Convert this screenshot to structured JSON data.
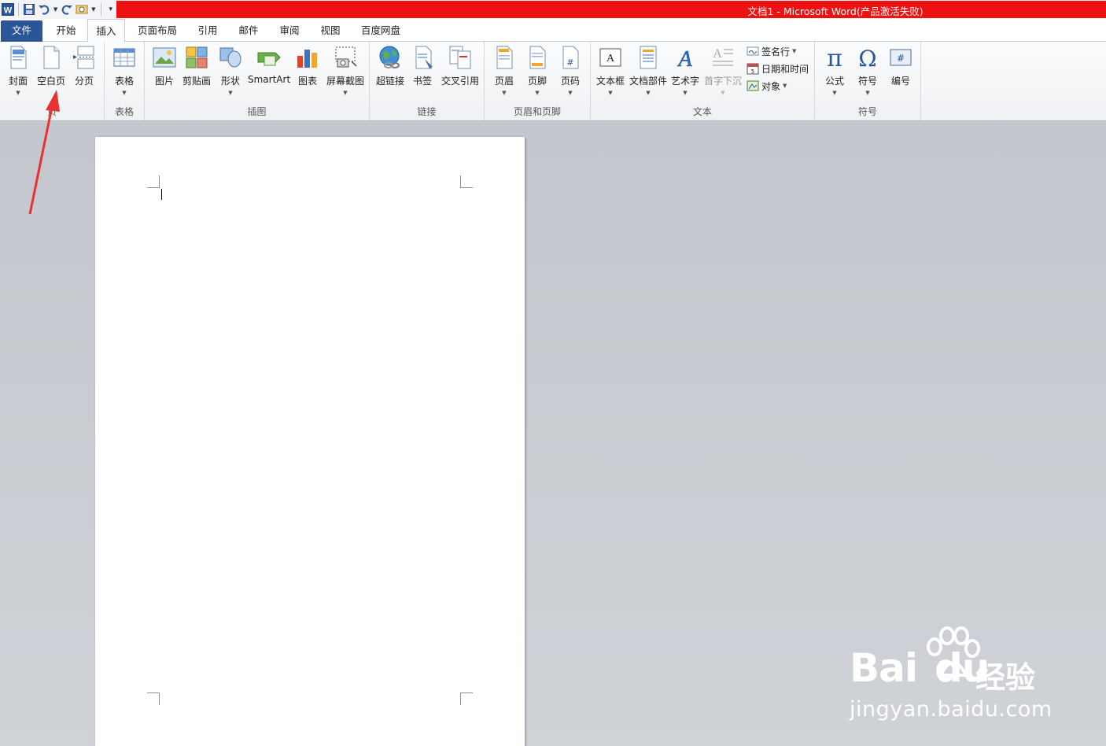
{
  "window": {
    "title": "文档1 - Microsoft Word(产品激活失败)",
    "title_bar_color": "#ee1111"
  },
  "quick_access": {
    "icons": [
      "word-logo-icon",
      "save-icon",
      "undo-icon",
      "redo-icon",
      "customize-icon",
      "dropdown-icon"
    ]
  },
  "tabs": [
    {
      "label": "文件"
    },
    {
      "label": "开始"
    },
    {
      "label": "插入"
    },
    {
      "label": "页面布局"
    },
    {
      "label": "引用"
    },
    {
      "label": "邮件"
    },
    {
      "label": "审阅"
    },
    {
      "label": "视图"
    },
    {
      "label": "百度网盘"
    }
  ],
  "active_tab": "插入",
  "ribbon": {
    "groups": [
      {
        "label": "页",
        "buttons": [
          "封面",
          "空白页",
          "分页"
        ]
      },
      {
        "label": "表格",
        "buttons": [
          "表格"
        ]
      },
      {
        "label": "插图",
        "buttons": [
          "图片",
          "剪贴画",
          "形状",
          "SmartArt",
          "图表",
          "屏幕截图"
        ]
      },
      {
        "label": "链接",
        "buttons": [
          "超链接",
          "书签",
          "交叉引用"
        ]
      },
      {
        "label": "页眉和页脚",
        "buttons": [
          "页眉",
          "页脚",
          "页码"
        ]
      },
      {
        "label": "文本",
        "buttons": [
          "文本框",
          "文档部件",
          "艺术字",
          "首字下沉"
        ],
        "small_buttons": [
          "签名行",
          "日期和时间",
          "对象"
        ]
      },
      {
        "label": "符号",
        "buttons": [
          "公式",
          "符号",
          "编号"
        ]
      }
    ]
  },
  "colors": {
    "file_tab": "#2a5699",
    "annotation_arrow": "#e8322f"
  },
  "watermark": {
    "logo": "Bai",
    "logo_suffix": "du",
    "cn": "经验",
    "url": "jingyan.baidu.com"
  }
}
